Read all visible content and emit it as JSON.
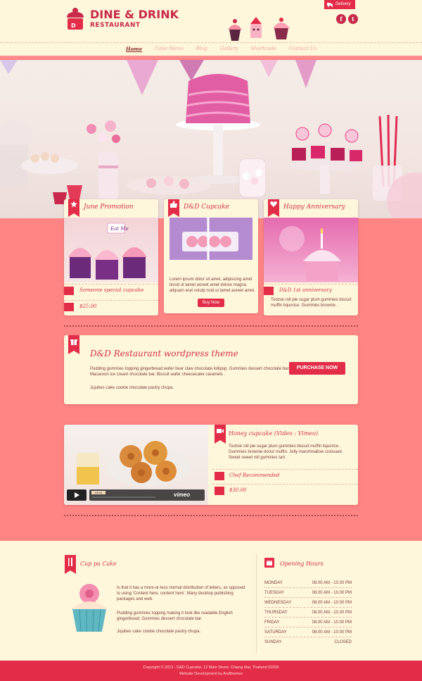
{
  "header": {
    "brand_line1": "DINE & DRINK",
    "brand_line2": "RESTAURANT",
    "delivery_label": "Delivery",
    "social": [
      {
        "icon": "facebook-icon",
        "label": "f"
      },
      {
        "icon": "twitter-icon",
        "label": "t"
      }
    ]
  },
  "nav": {
    "items": [
      "Home",
      "Cake Menu",
      "Blog",
      "Gallery",
      "Shortcode",
      "Contact Us"
    ],
    "active_index": 0
  },
  "slider": {
    "slides": 3,
    "active_slide": 1
  },
  "promos": [
    {
      "title": "June Promotion",
      "caption": "Someone special cupcake",
      "price": "$25.00"
    },
    {
      "title": "D&D Cupcake",
      "body": "Lorem ipsum dolor sit amet, adipiscing amet tincid ut lamet aoreet amet dolore magna aliquam erat volutp ncid ut lamet aoreet amet.",
      "button": "Buy Now"
    },
    {
      "title": "Happy Anniversary",
      "caption": "D&D 1st anniversary",
      "body": "Tootsie roll pie sugar plum gummies biscuit muffin liquorice. Gummies brownie ."
    }
  ],
  "feature": {
    "title": "D&D Restaurant wordpress theme",
    "para1": "Pudding gummies topping gingerbread wafer bear claw chocolate lollipop. Gummies dessert chocolate bar. Macaroon ice cream chocolate bar. Biscuit wafer cheesecake caramels .",
    "para2": "Jujubes cake cookie chocolate pastry chupa.",
    "button": "PURCHASE NOW"
  },
  "video": {
    "title": "Honey cupcake (Video : Vimeo)",
    "body": "Tootsie roll pie sugar plum gummies biscuit muffin liquorice . Gummies brownie donut muffin. Jelly marshmallow croissant. Sweet sweet roll gummies tart.",
    "chef": "Chef Recommended",
    "price": "$30.00",
    "time": "03:04",
    "player_brand": "vimeo"
  },
  "about": {
    "title": "Cup pa Cake",
    "para1": "Is that it has a more-or-less normal distribution of letters, as opposed to using 'Content here, content here'. Many desktop publishing packages and web.",
    "para2": "Pudding gummies topping making it look like readable English gingerbread. Gummies dessert chocolate bar.",
    "para3": "Jujubes cake cookie chocolate pastry chupa."
  },
  "hours": {
    "title": "Opening Hours",
    "rows": [
      {
        "day": "MONDAY",
        "time": "08.00 AM - 10.00 PM"
      },
      {
        "day": "TUESDAY",
        "time": "08.00 AM - 10.00 PM"
      },
      {
        "day": "WEDNESDAY",
        "time": "08.00 AM - 10.00 PM"
      },
      {
        "day": "THURSDAY",
        "time": "08.00 AM - 10.00 PM"
      },
      {
        "day": "FRIDAY",
        "time": "08.00 AM - 10.00 PM"
      },
      {
        "day": "SATURDAY",
        "time": "08.00 AM - 10.00 PM"
      },
      {
        "day": "SUNDAY",
        "time": "CLOSED"
      }
    ]
  },
  "footer": {
    "line1": "Copyright © 2013 - D&D Cupcake, 12 Main Street, Chiang Mai, Thailand 50300",
    "line2": "Website Development by Andthemes"
  },
  "colors": {
    "accent": "#e32d48",
    "background": "#ff8585",
    "cream": "#fff7dc"
  }
}
